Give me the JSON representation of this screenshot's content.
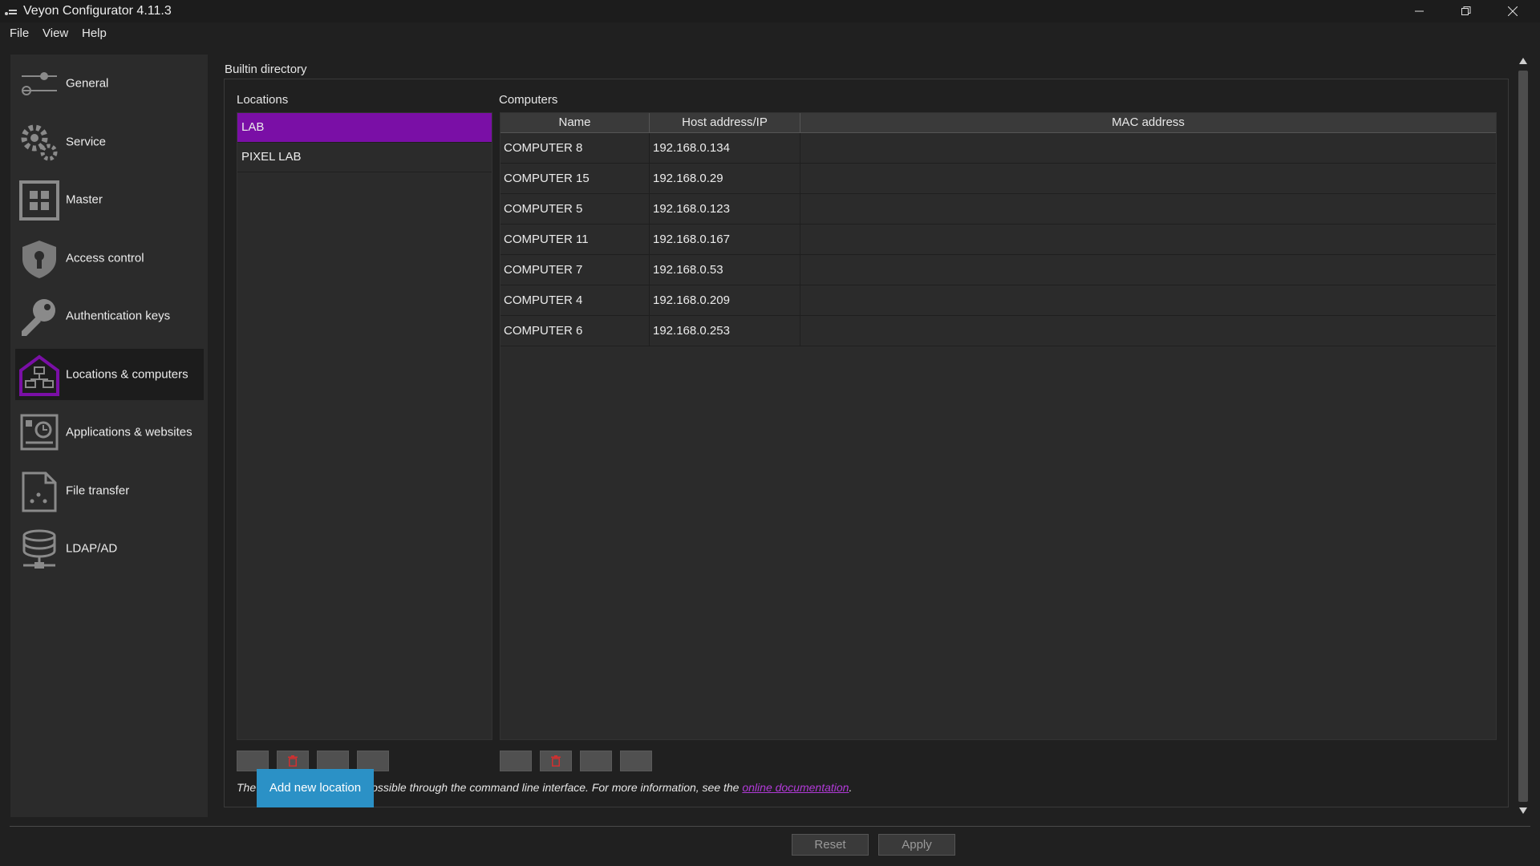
{
  "window": {
    "title": "Veyon Configurator 4.11.3",
    "icons": [
      "app-icon",
      "minimize-icon",
      "restore-icon",
      "close-icon"
    ]
  },
  "menu": [
    "File",
    "View",
    "Help"
  ],
  "sidebar": {
    "items": [
      {
        "label": "General",
        "icon": "slider-icon"
      },
      {
        "label": "Service",
        "icon": "gears-icon"
      },
      {
        "label": "Master",
        "icon": "grid-icon"
      },
      {
        "label": "Access control",
        "icon": "shield-lock-icon"
      },
      {
        "label": "Authentication keys",
        "icon": "key-icon"
      },
      {
        "label": "Locations & computers",
        "icon": "house-network-icon",
        "selected": true
      },
      {
        "label": "Applications & websites",
        "icon": "clock-screen-icon"
      },
      {
        "label": "File transfer",
        "icon": "file-icon"
      },
      {
        "label": "LDAP/AD",
        "icon": "database-icon"
      }
    ]
  },
  "main": {
    "section_title": "Builtin directory",
    "locations_label": "Locations",
    "computers_label": "Computers",
    "locations": [
      {
        "name": "LAB",
        "selected": true
      },
      {
        "name": "PIXEL LAB",
        "selected": false
      }
    ],
    "columns": [
      "Name",
      "Host address/IP",
      "MAC address"
    ],
    "computers": [
      {
        "name": "COMPUTER 8",
        "host": "192.168.0.134",
        "mac": ""
      },
      {
        "name": "COMPUTER 15",
        "host": "192.168.0.29",
        "mac": ""
      },
      {
        "name": "COMPUTER 5",
        "host": "192.168.0.123",
        "mac": ""
      },
      {
        "name": "COMPUTER 11",
        "host": "192.168.0.167",
        "mac": ""
      },
      {
        "name": "COMPUTER 7",
        "host": "192.168.0.53",
        "mac": ""
      },
      {
        "name": "COMPUTER 4",
        "host": "192.168.0.209",
        "mac": ""
      },
      {
        "name": "COMPUTER 6",
        "host": "192.168.0.253",
        "mac": ""
      }
    ],
    "info": {
      "prefix": "The",
      "text": "ossible through the command line interface. For more information, see the ",
      "link": "online documentation",
      "suffix": "."
    },
    "tooltip": "Add new location"
  },
  "bottom": {
    "reset": "Reset",
    "apply": "Apply"
  },
  "colors": {
    "accent": "#7a0fa6",
    "link": "#b23ad9",
    "tooltip": "#2b91c6",
    "delete": "#d03030",
    "background": "#202020",
    "panel": "#2b2b2b"
  }
}
